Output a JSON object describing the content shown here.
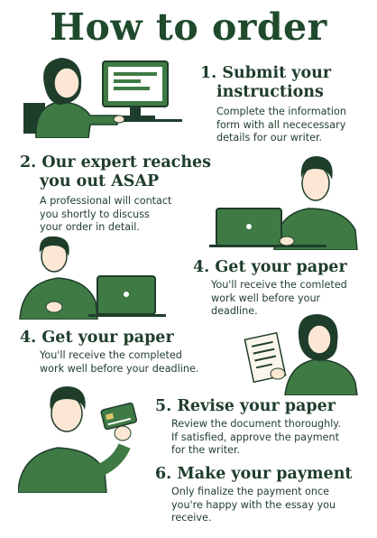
{
  "title": "How to order",
  "steps": [
    {
      "heading_1": "1. Submit your",
      "heading_2": "instructions",
      "body_1": "Complete the information",
      "body_2": "form with all nececessary",
      "body_3": "details for our writer."
    },
    {
      "heading_1": "2. Our expert reaches",
      "heading_2": "you out ASAP",
      "body_1": "A professional will contact",
      "body_2": "you shortly to discuss",
      "body_3": "your order in detail."
    },
    {
      "heading_1": "4. Get your paper",
      "body_1": "You'll receive the comleted",
      "body_2": "work well before your",
      "body_3": "deadline."
    },
    {
      "heading_1": "4. Get your paper",
      "body_1": "You'll receive the completed",
      "body_2": "work well before your deadline."
    },
    {
      "heading_1": "5. Revise your paper",
      "body_1": "Review the document thoroughly.",
      "body_2": "If satisfied, approve the payment",
      "body_3": "for the writer."
    },
    {
      "heading_1": "6. Make your payment",
      "body_1": "Only finalize the payment once",
      "body_2": "you're happy with the essay you",
      "body_3": "receive."
    }
  ],
  "colors": {
    "primary": "#3f7a45",
    "dark": "#1f3d2b",
    "skin": "#fbe7d3"
  },
  "illustrations": [
    "woman-at-computer",
    "man-with-laptop",
    "man-with-laptop-pointing",
    "woman-reading-paper",
    "man-holding-card"
  ]
}
